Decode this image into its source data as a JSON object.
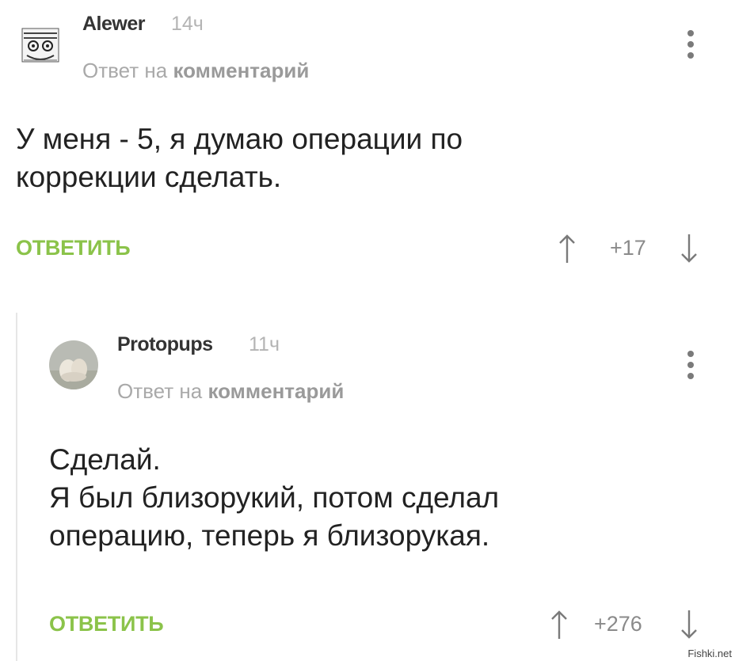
{
  "comments": [
    {
      "username": "Alewer",
      "time": "14ч",
      "reply_prefix": "Ответ на",
      "reply_link": "комментарий",
      "text": "У меня - 5, я думаю операции по\nкоррекции сделать.",
      "reply_button": "ОТВЕТИТЬ",
      "score": "+17",
      "avatar_icon": "doodle-avatar"
    },
    {
      "username": "Protopups",
      "time": "11ч",
      "reply_prefix": "Ответ на",
      "reply_link": "комментарий",
      "text": "Сделай.\nЯ был близорукий, потом сделал\nоперацию, теперь я близорукая.",
      "reply_button": "ОТВЕТИТЬ",
      "score": "+276",
      "avatar_icon": "photo-avatar"
    }
  ],
  "watermark": "Fishki.net",
  "colors": {
    "accent": "#8bc34a",
    "muted": "#a9a9a9",
    "text": "#222222"
  }
}
